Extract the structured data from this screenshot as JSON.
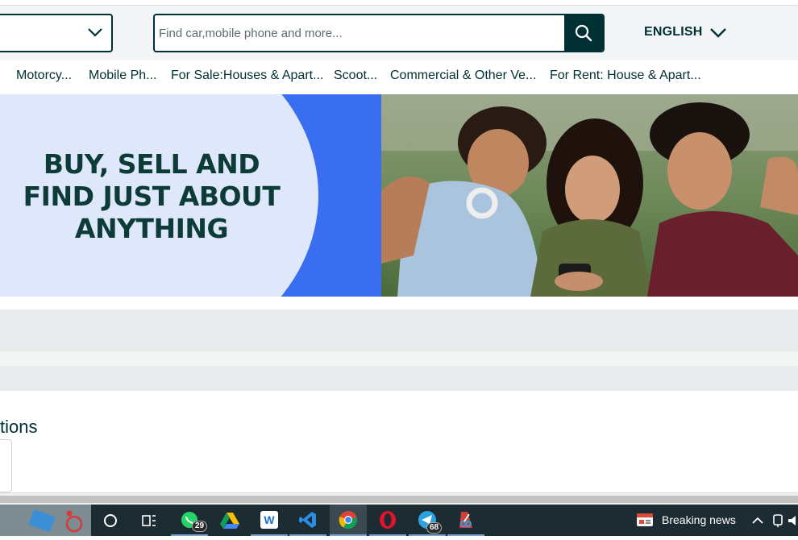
{
  "header": {
    "search": {
      "placeholder": "Find car,mobile phone and more..."
    },
    "language_label": "ENGLISH"
  },
  "categories": [
    "Motorcy...",
    "Mobile Ph...",
    "For Sale:Houses & Apart...",
    "Scoot...",
    "Commercial & Other Ve...",
    "For Rent: House & Apart..."
  ],
  "banner": {
    "line1": "BUY, SELL AND",
    "line2": "FIND JUST ABOUT",
    "line3": "ANYTHING"
  },
  "section": {
    "title_fragment": "tions"
  },
  "taskbar": {
    "icons": [
      "widgets-icon",
      "search-circle-icon",
      "task-view-icon",
      "whatsapp-icon",
      "google-drive-icon",
      "word-w-icon",
      "vscode-icon",
      "chrome-icon",
      "opera-icon",
      "telegram-icon",
      "snipping-tool-icon"
    ],
    "whatsapp_badge": "29",
    "telegram_badge": "68",
    "news_label": "Breaking news"
  },
  "colors": {
    "brand_dark": "#002f34",
    "banner_blue": "#3a6ef0",
    "banner_circle": "#dfe8fb",
    "taskbar": "#1d2b33"
  }
}
